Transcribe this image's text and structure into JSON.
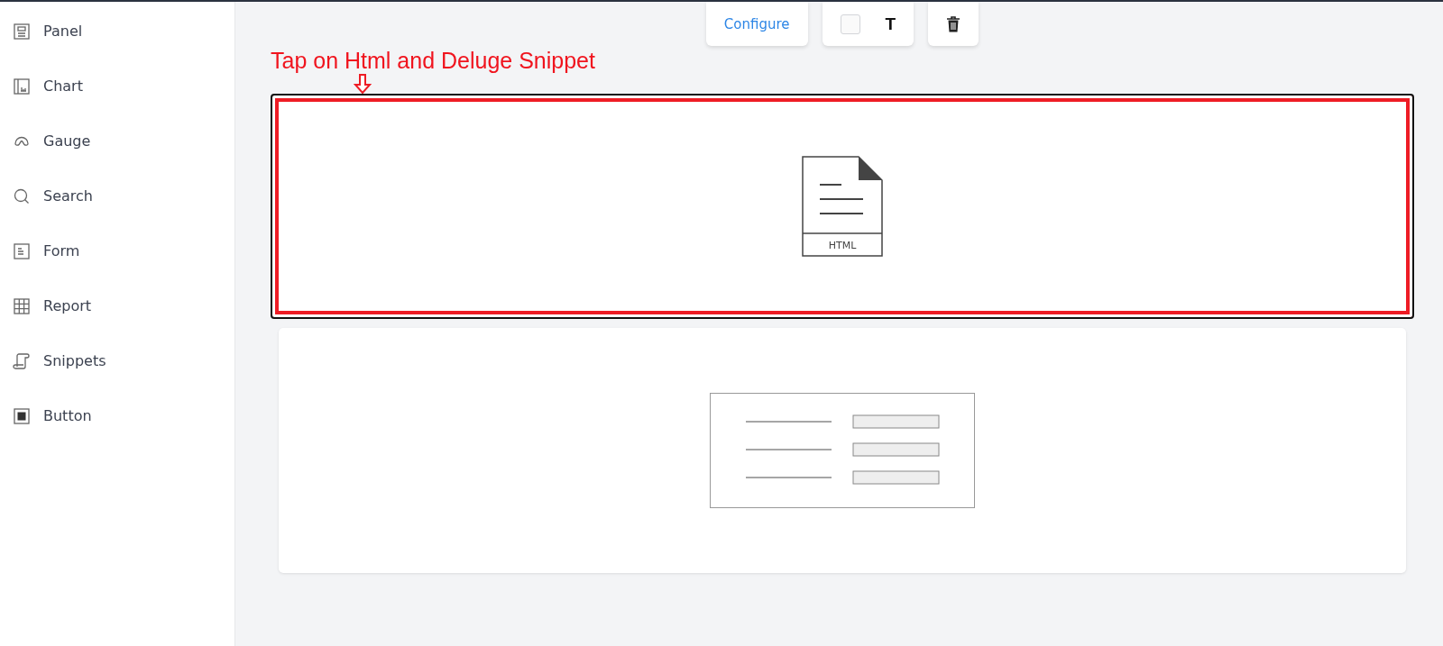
{
  "sidebar": {
    "items": [
      {
        "label": "Panel"
      },
      {
        "label": "Chart"
      },
      {
        "label": "Gauge"
      },
      {
        "label": "Search"
      },
      {
        "label": "Form"
      },
      {
        "label": "Report"
      },
      {
        "label": "Snippets"
      },
      {
        "label": "Button"
      }
    ]
  },
  "toolbar": {
    "configure": "Configure",
    "text_style": "T"
  },
  "annotation": "Tap on Html and Deluge Snippet",
  "cards": [
    {
      "kind": "html",
      "label": "HTML",
      "selected": true
    },
    {
      "kind": "form",
      "selected": false
    }
  ]
}
